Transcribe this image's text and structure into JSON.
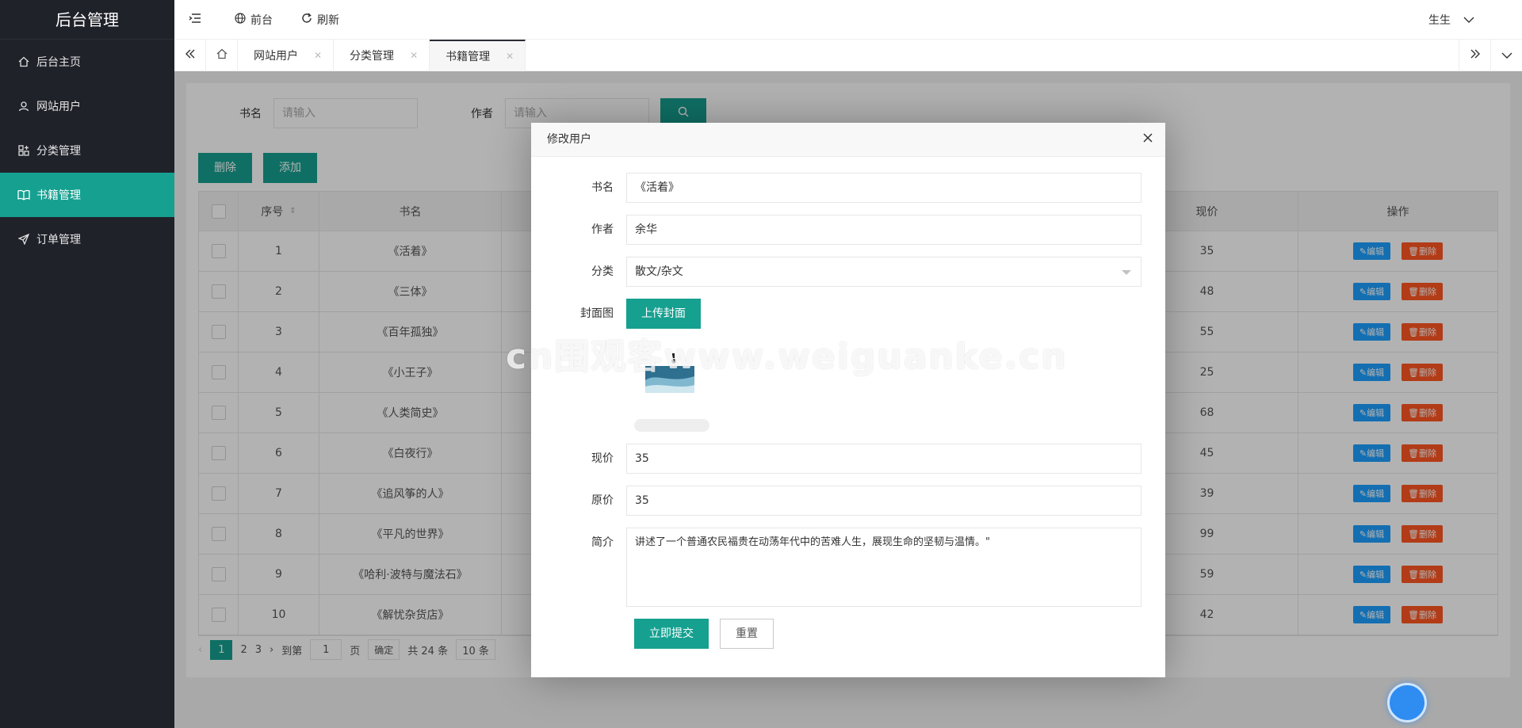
{
  "sidebar": {
    "logo": "后台管理",
    "items": [
      {
        "label": "后台主页",
        "icon": "home-icon"
      },
      {
        "label": "网站用户",
        "icon": "user-icon"
      },
      {
        "label": "分类管理",
        "icon": "category-icon"
      },
      {
        "label": "书籍管理",
        "icon": "book-icon",
        "active": true
      },
      {
        "label": "订单管理",
        "icon": "send-icon"
      }
    ]
  },
  "header": {
    "frontend_label": "前台",
    "refresh_label": "刷新",
    "user_name": "生生"
  },
  "tabs": [
    {
      "label": "网站用户"
    },
    {
      "label": "分类管理"
    },
    {
      "label": "书籍管理",
      "active": true
    }
  ],
  "search": {
    "book_label": "书名",
    "book_placeholder": "请输入",
    "author_label": "作者",
    "author_placeholder": "请输入"
  },
  "actions": {
    "delete_label": "删除",
    "add_label": "添加"
  },
  "table": {
    "headers": {
      "index": "序号",
      "name": "书名",
      "price": "现价",
      "ops": "操作"
    },
    "edit_label": "✎编辑",
    "delete_label": "🗑删除",
    "rows": [
      {
        "index": "1",
        "name": "《活着》",
        "price": "35"
      },
      {
        "index": "2",
        "name": "《三体》",
        "price": "48"
      },
      {
        "index": "3",
        "name": "《百年孤独》",
        "price": "55"
      },
      {
        "index": "4",
        "name": "《小王子》",
        "price": "25"
      },
      {
        "index": "5",
        "name": "《人类简史》",
        "price": "68"
      },
      {
        "index": "6",
        "name": "《白夜行》",
        "price": "45"
      },
      {
        "index": "7",
        "name": "《追风筝的人》",
        "price": "39"
      },
      {
        "index": "8",
        "name": "《平凡的世界》",
        "price": "99"
      },
      {
        "index": "9",
        "name": "《哈利·波特与魔法石》",
        "price": "59"
      },
      {
        "index": "10",
        "name": "《解忧杂货店》",
        "price": "42"
      }
    ]
  },
  "pager": {
    "pages": [
      "1",
      "2",
      "3"
    ],
    "goto_label": "到第",
    "goto_value": "1",
    "page_unit": "页",
    "confirm_label": "确定",
    "total_label": "共 24 条",
    "size_label": "10 条"
  },
  "modal": {
    "title": "修改用户",
    "fields": {
      "name_label": "书名",
      "name_value": "《活着》",
      "author_label": "作者",
      "author_value": "余华",
      "category_label": "分类",
      "category_value": "散文/杂文",
      "cover_label": "封面图",
      "upload_label": "上传封面",
      "price_label": "现价",
      "price_value": "35",
      "orig_label": "原价",
      "orig_value": "35",
      "intro_label": "简介",
      "intro_value": "讲述了一个普通农民福贵在动荡年代中的苦难人生，展现生命的坚韧与温情。\""
    },
    "upload_progress": 0,
    "submit_label": "立即提交",
    "reset_label": "重置"
  },
  "watermark": "cn围观客www.weiguanke.cn",
  "colors": {
    "accent": "#16a090",
    "sidebar": "#20222a",
    "edit": "#1e9fff",
    "delete": "#ff5722"
  }
}
